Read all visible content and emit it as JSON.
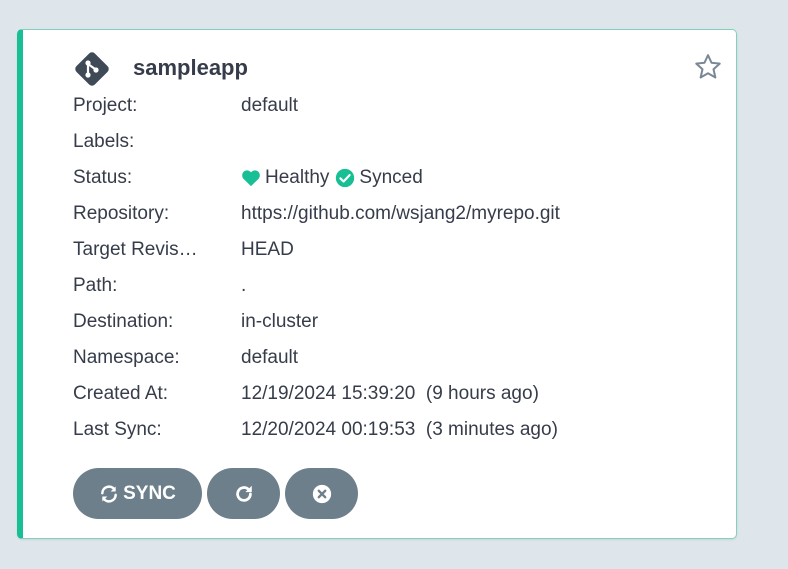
{
  "app": {
    "name": "sampleapp"
  },
  "fields": [
    {
      "label": "Project:",
      "value": "default"
    },
    {
      "label": "Labels:",
      "value": ""
    },
    {
      "label": "Status:",
      "value": ""
    },
    {
      "label": "Repository:",
      "value": "https://github.com/wsjang2/myrepo.git"
    },
    {
      "label": "Target Revis…",
      "value": "HEAD"
    },
    {
      "label": "Path:",
      "value": "."
    },
    {
      "label": "Destination:",
      "value": "in-cluster"
    },
    {
      "label": "Namespace:",
      "value": "default"
    },
    {
      "label": "Created At:",
      "value": "12/19/2024 15:39:20  (9 hours ago)"
    },
    {
      "label": "Last Sync:",
      "value": "12/20/2024 00:19:53  (3 minutes ago)"
    }
  ],
  "status": {
    "health": "Healthy",
    "sync": "Synced",
    "health_icon": "heart-icon",
    "sync_icon": "check-circle-icon"
  },
  "buttons": {
    "sync_label": "SYNC",
    "refresh_icon": "refresh-icon",
    "delete_icon": "times-circle-icon"
  },
  "colors": {
    "accent": "#18be94",
    "button": "#6d7f8b",
    "text": "#363c4a",
    "background": "#dee6eb"
  }
}
